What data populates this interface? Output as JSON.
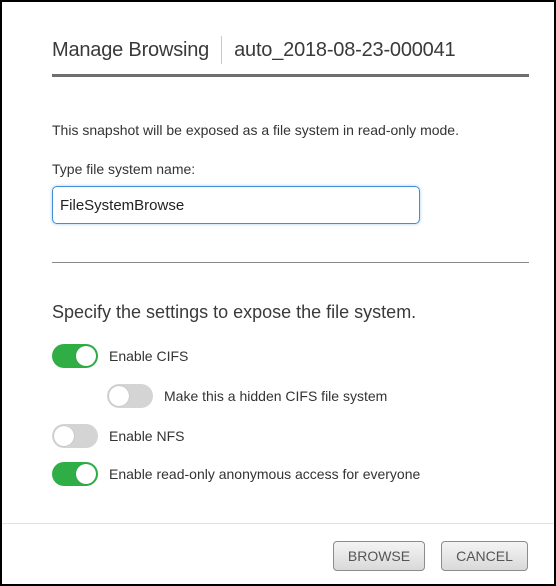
{
  "dialog": {
    "title": "Manage Browsing",
    "snapshot_name": "auto_2018-08-23-000041"
  },
  "form": {
    "description": "This snapshot will be exposed as a file system in read-only mode.",
    "name_label": "Type file system name:",
    "name_value": "FileSystemBrowse"
  },
  "settings": {
    "heading": "Specify the settings to expose the file system.",
    "toggles": [
      {
        "label": "Enable CIFS",
        "state": "on"
      },
      {
        "label": "Make this a hidden CIFS file system",
        "state": "off"
      },
      {
        "label": "Enable NFS",
        "state": "off"
      },
      {
        "label": "Enable read-only anonymous access for everyone",
        "state": "on"
      }
    ]
  },
  "buttons": {
    "browse": "BROWSE",
    "cancel": "CANCEL"
  },
  "colors": {
    "toggle_on": "#2fae46",
    "toggle_off": "#d4d4d4",
    "input_focus": "#3f8fd6"
  }
}
